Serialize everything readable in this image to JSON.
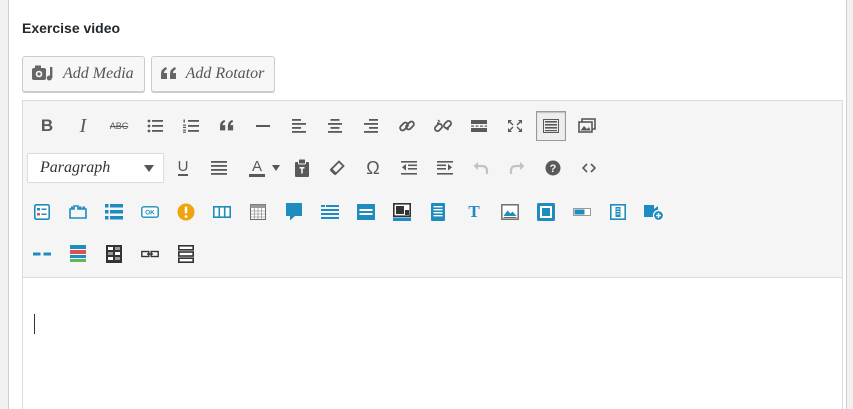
{
  "panel": {
    "title": "Exercise video"
  },
  "media_buttons": {
    "add_media": {
      "label": "Add Media",
      "icon": "camera-music-icon"
    },
    "add_rotator": {
      "label": "Add Rotator",
      "icon": "quote-icon"
    }
  },
  "toolbar": {
    "format_select": {
      "value": "Paragraph"
    },
    "row1": [
      "bold-icon",
      "italic-icon",
      "strikethrough-icon",
      "bullet-list-icon",
      "numbered-list-icon",
      "blockquote-icon",
      "horizontal-rule-icon",
      "align-left-icon",
      "align-center-icon",
      "align-right-icon",
      "link-icon",
      "unlink-icon",
      "read-more-icon",
      "fullscreen-icon",
      "toolbar-toggle-icon",
      "gallery-icon"
    ],
    "row2": [
      "underline-icon",
      "justify-icon",
      "text-color-icon",
      "paste-text-icon",
      "clear-formatting-icon",
      "special-character-icon",
      "outdent-icon",
      "indent-icon",
      "undo-icon",
      "redo-icon",
      "help-icon",
      "code-icon"
    ],
    "row3": [
      "shortcode-form-icon",
      "shortcode-tab-icon",
      "shortcode-list-icon",
      "shortcode-button-icon",
      "shortcode-alert-icon",
      "shortcode-columns-icon",
      "shortcode-table-icon",
      "shortcode-callout-icon",
      "shortcode-menu-icon",
      "shortcode-bar-icon",
      "shortcode-media-icon",
      "shortcode-document-icon",
      "shortcode-typography-icon",
      "shortcode-image-icon",
      "shortcode-frame-icon",
      "shortcode-progress-icon",
      "shortcode-column-icon",
      "shortcode-video-add-icon"
    ],
    "row4": [
      "shortcode-divider-icon",
      "shortcode-stack-icon",
      "shortcode-grid-icon",
      "shortcode-link-icon",
      "shortcode-rows-icon"
    ]
  },
  "colors": {
    "blue": "#1e8cbe",
    "dark": "#333333",
    "green": "#5cb85c",
    "red": "#d9534f",
    "orange": "#f0a30a"
  }
}
